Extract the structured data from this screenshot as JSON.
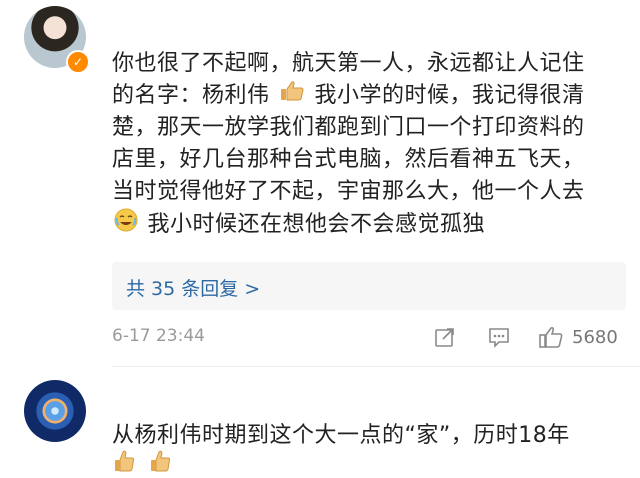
{
  "comments": [
    {
      "body_segments": [
        "你也很了不起啊，航天第一人，永远都让人记住",
        "的名字：杨利伟",
        "我小学的时候，我记得很清",
        "楚，那天一放学我们都跑到门口一个打印资料的",
        "店里，好几台那种台式电脑，然后看神五飞天，",
        "当时觉得他好了不起，宇宙那么大，他一个人去",
        "我小时候还在想他会不会感觉孤独"
      ],
      "reply_link": "共 35 条回复 >",
      "timestamp": "6-17 23:44",
      "like_count": "5680",
      "icons": [
        "thumbs-up-emoji-icon",
        "crying-laugh-emoji-icon",
        "share-icon",
        "comment-icon",
        "like-icon"
      ]
    },
    {
      "body_text": "从杨利伟时期到这个大一点的“家”，历时18年",
      "icons": [
        "thumbs-up-emoji-icon",
        "thumbs-up-emoji-icon"
      ]
    }
  ],
  "colors": {
    "link": "#2d6aa4",
    "meta": "#9a9a9a",
    "badge": "#ff8a00"
  }
}
